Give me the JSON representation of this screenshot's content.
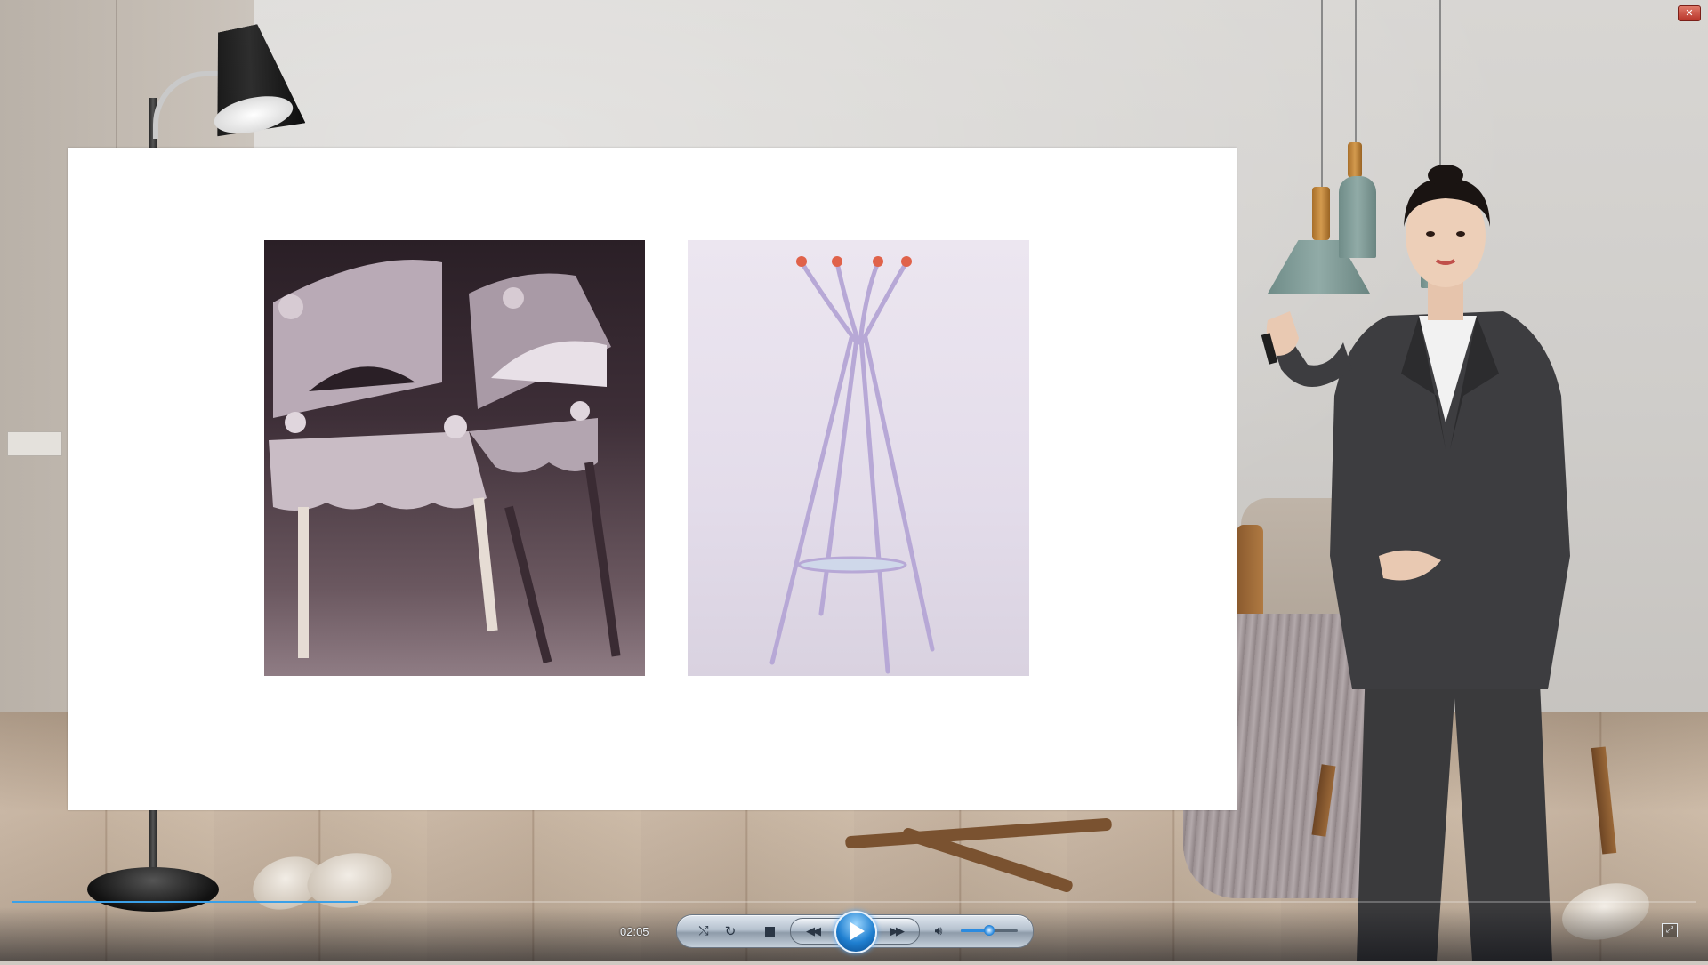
{
  "window": {
    "close_label": "✕"
  },
  "player": {
    "time": "02:05",
    "progress_fraction": 0.205,
    "volume_fraction": 0.5,
    "state": "paused",
    "controls": {
      "shuffle_icon": "shuffle-icon",
      "repeat_icon": "repeat-icon",
      "stop_icon": "stop-icon",
      "rewind_icon": "rewind-icon",
      "play_icon": "play-icon",
      "fast_forward_icon": "fast-forward-icon",
      "volume_icon": "speaker-icon",
      "fullscreen_icon": "fullscreen-icon"
    },
    "accent_color": "#2b8be0"
  },
  "slide": {
    "images": [
      {
        "subject": "sculptural chair photo"
      },
      {
        "subject": "coat rack photo"
      }
    ]
  }
}
